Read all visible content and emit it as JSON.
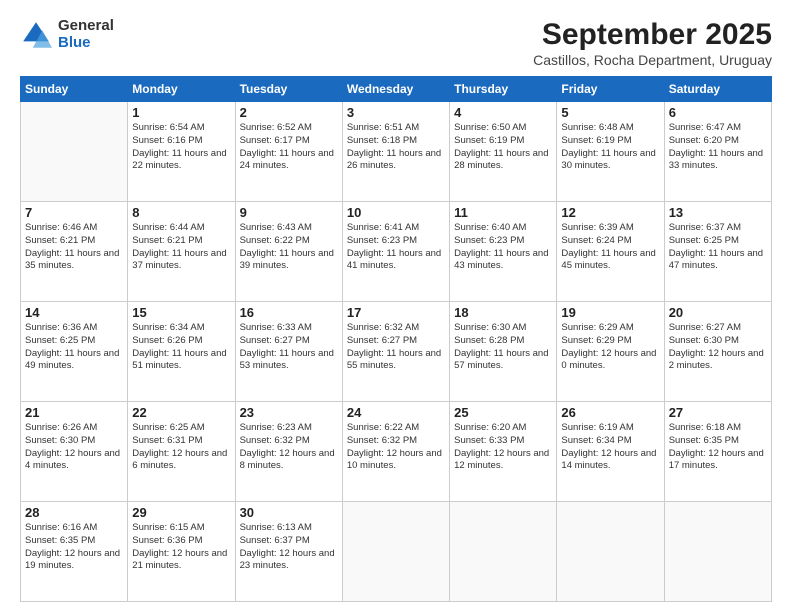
{
  "header": {
    "logo_general": "General",
    "logo_blue": "Blue",
    "month_title": "September 2025",
    "location": "Castillos, Rocha Department, Uruguay"
  },
  "weekdays": [
    "Sunday",
    "Monday",
    "Tuesday",
    "Wednesday",
    "Thursday",
    "Friday",
    "Saturday"
  ],
  "weeks": [
    [
      {
        "num": "",
        "info": ""
      },
      {
        "num": "1",
        "info": "Sunrise: 6:54 AM\nSunset: 6:16 PM\nDaylight: 11 hours\nand 22 minutes."
      },
      {
        "num": "2",
        "info": "Sunrise: 6:52 AM\nSunset: 6:17 PM\nDaylight: 11 hours\nand 24 minutes."
      },
      {
        "num": "3",
        "info": "Sunrise: 6:51 AM\nSunset: 6:18 PM\nDaylight: 11 hours\nand 26 minutes."
      },
      {
        "num": "4",
        "info": "Sunrise: 6:50 AM\nSunset: 6:19 PM\nDaylight: 11 hours\nand 28 minutes."
      },
      {
        "num": "5",
        "info": "Sunrise: 6:48 AM\nSunset: 6:19 PM\nDaylight: 11 hours\nand 30 minutes."
      },
      {
        "num": "6",
        "info": "Sunrise: 6:47 AM\nSunset: 6:20 PM\nDaylight: 11 hours\nand 33 minutes."
      }
    ],
    [
      {
        "num": "7",
        "info": "Sunrise: 6:46 AM\nSunset: 6:21 PM\nDaylight: 11 hours\nand 35 minutes."
      },
      {
        "num": "8",
        "info": "Sunrise: 6:44 AM\nSunset: 6:21 PM\nDaylight: 11 hours\nand 37 minutes."
      },
      {
        "num": "9",
        "info": "Sunrise: 6:43 AM\nSunset: 6:22 PM\nDaylight: 11 hours\nand 39 minutes."
      },
      {
        "num": "10",
        "info": "Sunrise: 6:41 AM\nSunset: 6:23 PM\nDaylight: 11 hours\nand 41 minutes."
      },
      {
        "num": "11",
        "info": "Sunrise: 6:40 AM\nSunset: 6:23 PM\nDaylight: 11 hours\nand 43 minutes."
      },
      {
        "num": "12",
        "info": "Sunrise: 6:39 AM\nSunset: 6:24 PM\nDaylight: 11 hours\nand 45 minutes."
      },
      {
        "num": "13",
        "info": "Sunrise: 6:37 AM\nSunset: 6:25 PM\nDaylight: 11 hours\nand 47 minutes."
      }
    ],
    [
      {
        "num": "14",
        "info": "Sunrise: 6:36 AM\nSunset: 6:25 PM\nDaylight: 11 hours\nand 49 minutes."
      },
      {
        "num": "15",
        "info": "Sunrise: 6:34 AM\nSunset: 6:26 PM\nDaylight: 11 hours\nand 51 minutes."
      },
      {
        "num": "16",
        "info": "Sunrise: 6:33 AM\nSunset: 6:27 PM\nDaylight: 11 hours\nand 53 minutes."
      },
      {
        "num": "17",
        "info": "Sunrise: 6:32 AM\nSunset: 6:27 PM\nDaylight: 11 hours\nand 55 minutes."
      },
      {
        "num": "18",
        "info": "Sunrise: 6:30 AM\nSunset: 6:28 PM\nDaylight: 11 hours\nand 57 minutes."
      },
      {
        "num": "19",
        "info": "Sunrise: 6:29 AM\nSunset: 6:29 PM\nDaylight: 12 hours\nand 0 minutes."
      },
      {
        "num": "20",
        "info": "Sunrise: 6:27 AM\nSunset: 6:30 PM\nDaylight: 12 hours\nand 2 minutes."
      }
    ],
    [
      {
        "num": "21",
        "info": "Sunrise: 6:26 AM\nSunset: 6:30 PM\nDaylight: 12 hours\nand 4 minutes."
      },
      {
        "num": "22",
        "info": "Sunrise: 6:25 AM\nSunset: 6:31 PM\nDaylight: 12 hours\nand 6 minutes."
      },
      {
        "num": "23",
        "info": "Sunrise: 6:23 AM\nSunset: 6:32 PM\nDaylight: 12 hours\nand 8 minutes."
      },
      {
        "num": "24",
        "info": "Sunrise: 6:22 AM\nSunset: 6:32 PM\nDaylight: 12 hours\nand 10 minutes."
      },
      {
        "num": "25",
        "info": "Sunrise: 6:20 AM\nSunset: 6:33 PM\nDaylight: 12 hours\nand 12 minutes."
      },
      {
        "num": "26",
        "info": "Sunrise: 6:19 AM\nSunset: 6:34 PM\nDaylight: 12 hours\nand 14 minutes."
      },
      {
        "num": "27",
        "info": "Sunrise: 6:18 AM\nSunset: 6:35 PM\nDaylight: 12 hours\nand 17 minutes."
      }
    ],
    [
      {
        "num": "28",
        "info": "Sunrise: 6:16 AM\nSunset: 6:35 PM\nDaylight: 12 hours\nand 19 minutes."
      },
      {
        "num": "29",
        "info": "Sunrise: 6:15 AM\nSunset: 6:36 PM\nDaylight: 12 hours\nand 21 minutes."
      },
      {
        "num": "30",
        "info": "Sunrise: 6:13 AM\nSunset: 6:37 PM\nDaylight: 12 hours\nand 23 minutes."
      },
      {
        "num": "",
        "info": ""
      },
      {
        "num": "",
        "info": ""
      },
      {
        "num": "",
        "info": ""
      },
      {
        "num": "",
        "info": ""
      }
    ]
  ]
}
